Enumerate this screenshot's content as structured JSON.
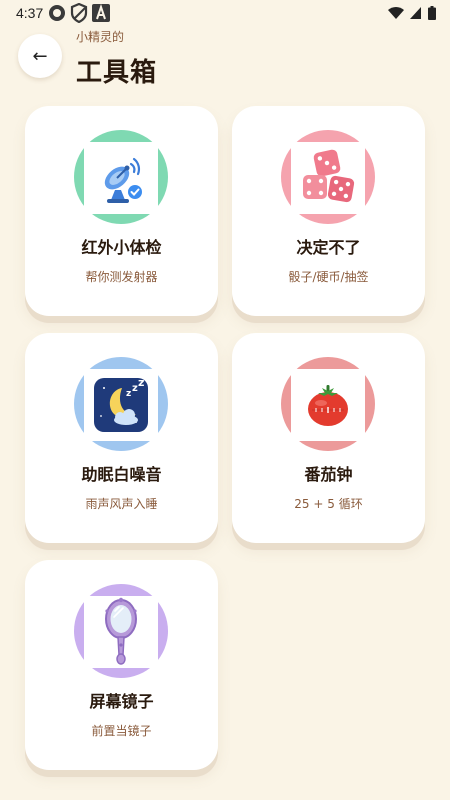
{
  "status_bar": {
    "time": "4:37",
    "left_icons": [
      "record-icon",
      "shield-icon",
      "font-a-icon"
    ],
    "right_icons": [
      "wifi-icon",
      "signal-icon",
      "battery-icon"
    ]
  },
  "header": {
    "back_label": "←",
    "subtitle": "小精灵的",
    "title": "工具箱"
  },
  "tools": [
    {
      "title": "红外小体检",
      "desc": "帮你测发射器",
      "icon": "satellite-dish-icon",
      "ring_color": "#7FD9B2"
    },
    {
      "title": "决定不了",
      "desc": "骰子/硬币/抽签",
      "icon": "dice-icon",
      "ring_color": "#F5A3AE"
    },
    {
      "title": "助眠白噪音",
      "desc": "雨声风声入睡",
      "icon": "moon-sleep-icon",
      "ring_color": "#9FC6EF"
    },
    {
      "title": "番茄钟",
      "desc": "25 + 5 循环",
      "icon": "tomato-timer-icon",
      "ring_color": "#EC9A9A"
    },
    {
      "title": "屏幕镜子",
      "desc": "前置当镜子",
      "icon": "hand-mirror-icon",
      "ring_color": "#C9AEEF"
    }
  ]
}
